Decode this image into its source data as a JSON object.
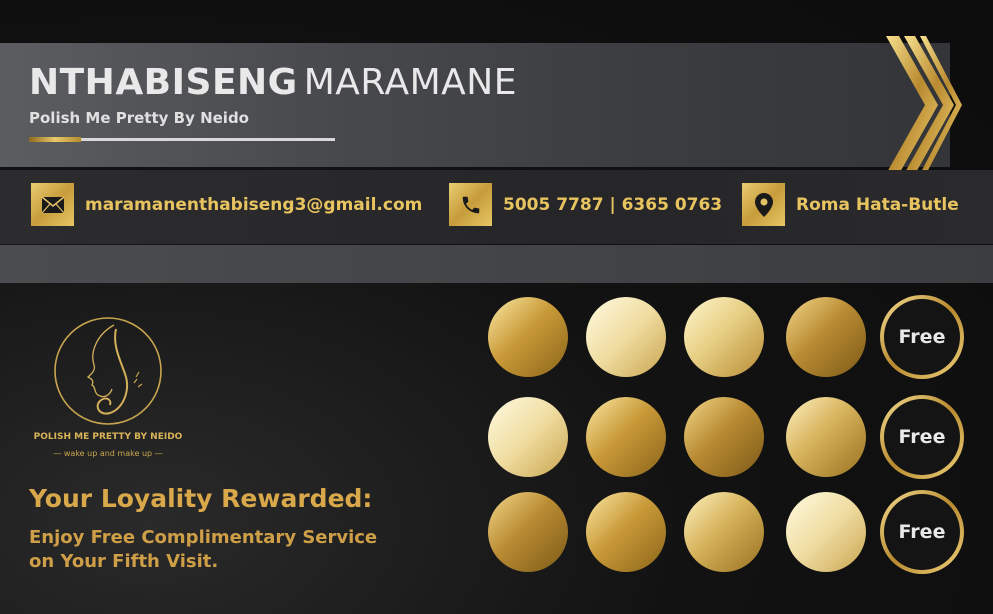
{
  "header": {
    "first_name": "NTHABISENG",
    "last_name": "MARAMANE",
    "company": "Polish Me Pretty By Neido"
  },
  "contacts": [
    {
      "icon": "mail-icon",
      "text": "maramanenthabiseng3@gmail.com"
    },
    {
      "icon": "phone-icon",
      "text": "5005 7787 | 6365 0763"
    },
    {
      "icon": "location-pin-icon",
      "text": "Roma Hata-Butle"
    }
  ],
  "logo": {
    "title": "POLISH ME PRETTY BY NEIDO",
    "tagline": "— wake up and make up —"
  },
  "promo": {
    "headline": "Your Loyality Rewarded:",
    "line1": "Enjoy Free Complimentary Service",
    "line2": "on Your Fifth Visit."
  },
  "stamps": {
    "rows": 3,
    "stamps_per_row": 4,
    "reward_label": "Free"
  },
  "colors": {
    "gold": "#d9b458",
    "dark_background": "#111111",
    "band_grey": "#4a4c4f",
    "name_white": "#e9e9e9"
  }
}
